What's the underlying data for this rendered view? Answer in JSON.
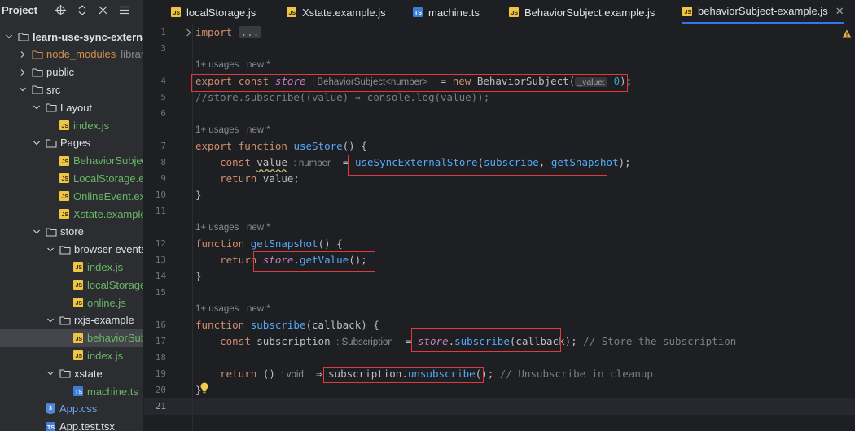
{
  "project_panel": {
    "title": "Project",
    "tree": [
      {
        "label": "learn-use-sync-external",
        "depth": 0,
        "kind": "folder",
        "expanded": true,
        "style": "bold"
      },
      {
        "label": "node_modules",
        "hint": "library root",
        "depth": 1,
        "kind": "folder-excluded",
        "expanded": false,
        "style": "excluded"
      },
      {
        "label": "public",
        "depth": 1,
        "kind": "folder",
        "expanded": false,
        "style": "plain"
      },
      {
        "label": "src",
        "depth": 1,
        "kind": "folder",
        "expanded": true,
        "style": "plain"
      },
      {
        "label": "Layout",
        "depth": 2,
        "kind": "folder",
        "expanded": true,
        "style": "plain"
      },
      {
        "label": "index.js",
        "depth": 3,
        "kind": "js",
        "style": "green"
      },
      {
        "label": "Pages",
        "depth": 2,
        "kind": "folder",
        "expanded": true,
        "style": "plain"
      },
      {
        "label": "BehaviorSubject.example.js",
        "depth": 3,
        "kind": "js",
        "style": "green"
      },
      {
        "label": "LocalStorage.example.js",
        "depth": 3,
        "kind": "js",
        "style": "green"
      },
      {
        "label": "OnlineEvent.example.js",
        "depth": 3,
        "kind": "js",
        "style": "green"
      },
      {
        "label": "Xstate.example.js",
        "depth": 3,
        "kind": "js",
        "style": "green"
      },
      {
        "label": "store",
        "depth": 2,
        "kind": "folder",
        "expanded": true,
        "style": "plain"
      },
      {
        "label": "browser-events",
        "depth": 3,
        "kind": "folder",
        "expanded": true,
        "style": "plain"
      },
      {
        "label": "index.js",
        "depth": 4,
        "kind": "js",
        "style": "green"
      },
      {
        "label": "localStorage.js",
        "depth": 4,
        "kind": "js",
        "style": "green"
      },
      {
        "label": "online.js",
        "depth": 4,
        "kind": "js",
        "style": "green"
      },
      {
        "label": "rxjs-example",
        "depth": 3,
        "kind": "folder",
        "expanded": true,
        "style": "plain"
      },
      {
        "label": "behaviorSubject-example.js",
        "depth": 4,
        "kind": "js",
        "style": "green",
        "selected": true
      },
      {
        "label": "index.js",
        "depth": 4,
        "kind": "js",
        "style": "green"
      },
      {
        "label": "xstate",
        "depth": 3,
        "kind": "folder",
        "expanded": true,
        "style": "plain"
      },
      {
        "label": "machine.ts",
        "depth": 4,
        "kind": "ts",
        "style": "green"
      },
      {
        "label": "App.css",
        "depth": 2,
        "kind": "css",
        "style": "blue"
      },
      {
        "label": "App.test.tsx",
        "depth": 2,
        "kind": "ts",
        "style": "plain"
      }
    ]
  },
  "tabs": [
    {
      "label": "localStorage.js",
      "kind": "js",
      "active": false
    },
    {
      "label": "Xstate.example.js",
      "kind": "js",
      "active": false
    },
    {
      "label": "machine.ts",
      "kind": "ts",
      "active": false
    },
    {
      "label": "BehaviorSubject.example.js",
      "kind": "js",
      "active": false
    },
    {
      "label": "behaviorSubject-example.js",
      "kind": "js",
      "active": true
    }
  ],
  "editor": {
    "current_line": 21,
    "usages_label": "1+ usages",
    "new_label": "new *",
    "lines": {
      "l1_kw": "import",
      "l1_fold": "...",
      "l4_export": "export",
      "l4_const": "const",
      "l4_name": "store",
      "l4_type_hint": ": BehaviorSubject<number>",
      "l4_eq": "=",
      "l4_new": "new",
      "l4_class": "BehaviorSubject(",
      "l4_param_hint": "_value:",
      "l4_num": "0",
      "l4_end": ");",
      "l5": "//store.subscribe((value) ⇒ console.log(value));",
      "l7_export": "export",
      "l7_function": "function",
      "l7_name": "useStore",
      "l7_rest": "() {",
      "l8_const": "const",
      "l8_name": "value",
      "l8_type_hint": ": number",
      "l8_eq": "=",
      "l8_call": "useSyncExternalStore",
      "l8_open": "(",
      "l8_arg1": "subscribe",
      "l8_comma": ", ",
      "l8_arg2": "getSnapshot",
      "l8_end": ");",
      "l9_return": "return",
      "l9_rest": " value;",
      "l10": "}",
      "l12_function": "function",
      "l12_name": "getSnapshot",
      "l12_rest": "() {",
      "l13_return": "return",
      "l13_store": "store",
      "l13_dot": ".",
      "l13_call": "getValue",
      "l13_end": "();",
      "l14": "}",
      "l16_function": "function",
      "l16_name": "subscribe",
      "l16_rest": "(callback) {",
      "l17_const": "const",
      "l17_name": "subscription",
      "l17_type_hint": ": Subscription",
      "l17_eq": "=",
      "l17_store": "store",
      "l17_dot": ".",
      "l17_call": "subscribe",
      "l17_args": "(callback);",
      "l17_comment": "// Store the subscription",
      "l19_return": "return",
      "l19_parens": "()",
      "l19_type_hint": ": void",
      "l19_arrow": "⇒",
      "l19_obj": "subscription.",
      "l19_call": "unsubscribe",
      "l19_end": "();",
      "l19_comment": "// Unsubscribe in cleanup",
      "l20": "}"
    }
  }
}
